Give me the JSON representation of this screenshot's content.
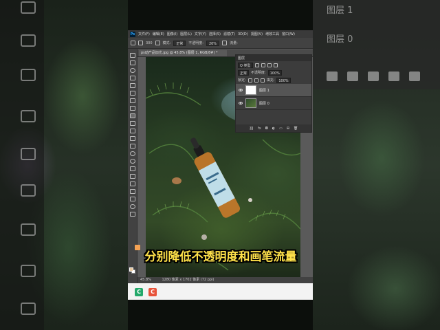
{
  "background": {
    "left_toolbar_ghost": "e",
    "right_panel_ghost_top": "图层 1",
    "right_panel_ghost_bottom": "图层 0"
  },
  "menubar": {
    "logo": "Ps",
    "items": [
      "文件(F)",
      "编辑(E)",
      "图像(I)",
      "图层(L)",
      "文字(Y)",
      "选择(S)",
      "滤镜(T)",
      "3D(D)",
      "视图(V)",
      "增效工具",
      "窗口(W)"
    ]
  },
  "options_bar": {
    "brush_size": "300",
    "mode_label": "模式:",
    "mode_value": "正常",
    "opacity_label": "不透明度:",
    "opacity_value": "20%",
    "flow_label": "流量:"
  },
  "document_tab": {
    "title": "ps动产品加光.jpg @ 45.8% (图层 1, RGB/8#) *"
  },
  "status_bar": {
    "zoom": "45.8%",
    "doc_info": "1280 像素 x 1702 像素 (72 ppi)"
  },
  "layers_panel": {
    "tab": "图层",
    "filter_kind": "Q 类型",
    "blend_mode": "正常",
    "opacity_label": "不透明度:",
    "opacity_value": "100%",
    "lock_label": "锁定:",
    "fill_label": "填充:",
    "fill_value": "100%",
    "layers": [
      {
        "name": "图层 1",
        "selected": true
      },
      {
        "name": "图层 0",
        "selected": false
      }
    ],
    "footer_icons": [
      "link-icon",
      "fx",
      "mask-icon",
      "adjustment-icon",
      "group-icon",
      "new-layer-icon",
      "trash-icon"
    ]
  },
  "caption": "分别降低不透明度和画笔流量",
  "taskbar": {
    "icons": [
      "app-icon-green",
      "app-icon-orange"
    ]
  }
}
